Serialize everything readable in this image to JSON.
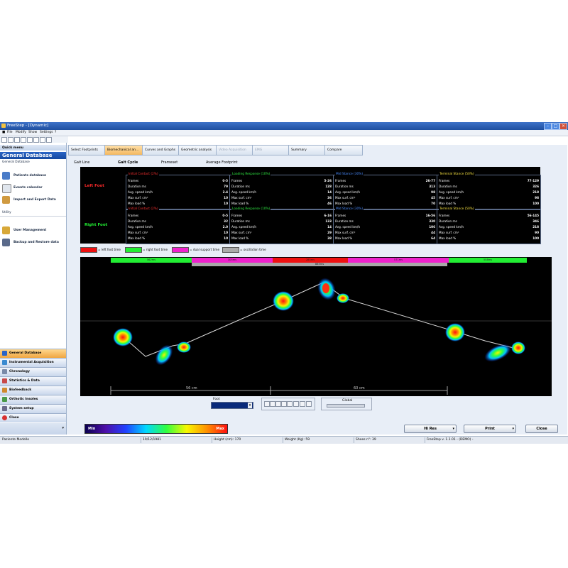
{
  "window": {
    "title": "FreeStep - [Dynamic]"
  },
  "menu": [
    "File",
    "Modify",
    "Show",
    "Settings",
    "?"
  ],
  "left_panel": {
    "quick_menu": "Quick menu",
    "title": "General Database",
    "section_general": "General Database",
    "items_general": [
      "Patients database",
      "Events calendar",
      "Import and Export Data"
    ],
    "section_utility": "Utility",
    "items_utility": [
      "User Management",
      "Backup and Restore data"
    ],
    "nav": [
      "General Database",
      "Instrumental Acquisition",
      "Chronology",
      "Statistics & Data",
      "Biofeedback",
      "Orthotic Insoles",
      "System setup",
      "Close"
    ]
  },
  "tabs": [
    "Select Footprints",
    "Biomechanical an...",
    "Curves and Graphs",
    "Geometric analysis",
    "Video Acquisition",
    "EMG",
    "Summary",
    "Compare"
  ],
  "subtabs": [
    "Gait Line",
    "Gait Cycle",
    "Frameset",
    "Average Footprint"
  ],
  "stats": {
    "left_label": "Left Foot",
    "right_label": "Right Foot",
    "row_keys": [
      "Frames",
      "Duration ms",
      "Avg. speed km/h",
      "Max surf. cm²",
      "Max load %"
    ],
    "left": [
      {
        "title": "Initial Contact (2%)",
        "values": [
          "0-5",
          "79",
          "2.4",
          "10",
          "10"
        ]
      },
      {
        "title": "Loading Response (10%)",
        "values": [
          "5-26",
          "128",
          "14",
          "36",
          "46"
        ]
      },
      {
        "title": "Mid Stance (30%)",
        "values": [
          "26-77",
          "313",
          "98",
          "45",
          "70"
        ]
      },
      {
        "title": "Terminal Stance (50%)",
        "values": [
          "77-129",
          "326",
          "218",
          "98",
          "100"
        ]
      }
    ],
    "right": [
      {
        "title": "Initial Contact (2%)",
        "values": [
          "0-5",
          "32",
          "2.0",
          "10",
          "10"
        ]
      },
      {
        "title": "Loading Response (10%)",
        "values": [
          "6-16",
          "133",
          "14",
          "29",
          "38"
        ]
      },
      {
        "title": "Mid Stance (30%)",
        "values": [
          "16-56",
          "330",
          "106",
          "44",
          "64"
        ]
      },
      {
        "title": "Terminal Stance (50%)",
        "values": [
          "56-145",
          "346",
          "218",
          "90",
          "100"
        ]
      }
    ]
  },
  "legend": [
    {
      "label": "= left foot time",
      "color": "#ee1111"
    },
    {
      "label": "= right foot time",
      "color": "#22ee33"
    },
    {
      "label": "= dual support time",
      "color": "#ee22cc"
    },
    {
      "label": "= oscillation time",
      "color": "#aaaaaa"
    }
  ],
  "phases": {
    "top": [
      {
        "label": "562ms",
        "color": "#22ee33"
      },
      {
        "label": "305ms",
        "color": "#ee22cc"
      },
      {
        "label": "285ms",
        "color": "#ee1111"
      },
      {
        "label": "571ms",
        "color": "#ee22cc"
      },
      {
        "label": "558ms",
        "color": "#22ee33"
      }
    ],
    "gray": "885ms"
  },
  "distances": [
    "56 cm",
    "60 cm"
  ],
  "controls": {
    "foot_label": "Foot",
    "global_label": "Global"
  },
  "scale": {
    "min": "Min",
    "max": "Max"
  },
  "buttons": {
    "hires": "Hi Res",
    "print": "Print",
    "close": "Close"
  },
  "status": {
    "patient": "Paziente Modello",
    "date": "19/12/1981",
    "height": "Height (cm): 170",
    "weight": "Weight (Kg): 59",
    "shoes": "Shoes n°: 39",
    "version": "FreeStep v. 1.1.01 - (DEMO) -"
  }
}
